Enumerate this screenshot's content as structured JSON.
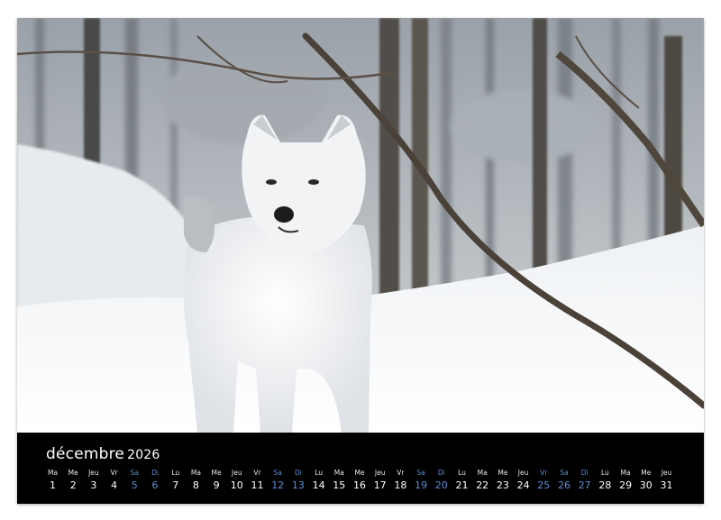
{
  "calendar": {
    "month": "décembre",
    "year": "2026",
    "days": [
      {
        "dow": "Ma",
        "num": "1",
        "weekend": false
      },
      {
        "dow": "Me",
        "num": "2",
        "weekend": false
      },
      {
        "dow": "Jeu",
        "num": "3",
        "weekend": false
      },
      {
        "dow": "Vr",
        "num": "4",
        "weekend": false
      },
      {
        "dow": "Sa",
        "num": "5",
        "weekend": true
      },
      {
        "dow": "Di",
        "num": "6",
        "weekend": true
      },
      {
        "dow": "Lu",
        "num": "7",
        "weekend": false
      },
      {
        "dow": "Ma",
        "num": "8",
        "weekend": false
      },
      {
        "dow": "Me",
        "num": "9",
        "weekend": false
      },
      {
        "dow": "Jeu",
        "num": "10",
        "weekend": false
      },
      {
        "dow": "Vr",
        "num": "11",
        "weekend": false
      },
      {
        "dow": "Sa",
        "num": "12",
        "weekend": true
      },
      {
        "dow": "Di",
        "num": "13",
        "weekend": true
      },
      {
        "dow": "Lu",
        "num": "14",
        "weekend": false
      },
      {
        "dow": "Ma",
        "num": "15",
        "weekend": false
      },
      {
        "dow": "Me",
        "num": "16",
        "weekend": false
      },
      {
        "dow": "Jeu",
        "num": "17",
        "weekend": false
      },
      {
        "dow": "Vr",
        "num": "18",
        "weekend": false
      },
      {
        "dow": "Sa",
        "num": "19",
        "weekend": true
      },
      {
        "dow": "Di",
        "num": "20",
        "weekend": true
      },
      {
        "dow": "Lu",
        "num": "21",
        "weekend": false
      },
      {
        "dow": "Ma",
        "num": "22",
        "weekend": false
      },
      {
        "dow": "Me",
        "num": "23",
        "weekend": false
      },
      {
        "dow": "Jeu",
        "num": "24",
        "weekend": false
      },
      {
        "dow": "Vr",
        "num": "25",
        "weekend": true
      },
      {
        "dow": "Sa",
        "num": "26",
        "weekend": true
      },
      {
        "dow": "Di",
        "num": "27",
        "weekend": true
      },
      {
        "dow": "Lu",
        "num": "28",
        "weekend": false
      },
      {
        "dow": "Ma",
        "num": "29",
        "weekend": false
      },
      {
        "dow": "Me",
        "num": "30",
        "weekend": false
      },
      {
        "dow": "Jeu",
        "num": "31",
        "weekend": false
      }
    ]
  },
  "colors": {
    "calendar_background": "#000000",
    "weekday_text": "#ffffff",
    "weekend_text": "#5a8fd6"
  },
  "photo": {
    "subject": "white-wolf-in-snowy-forest"
  }
}
